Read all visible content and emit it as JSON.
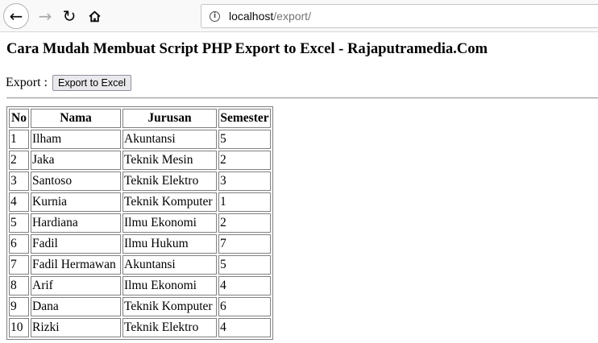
{
  "browser": {
    "url_host": "localhost",
    "url_path": "/export/",
    "icons": {
      "back": "back-arrow-icon",
      "forward": "forward-arrow-icon",
      "reload": "reload-icon",
      "home": "home-icon",
      "info": "info-icon"
    }
  },
  "page": {
    "title": "Cara Mudah Membuat Script PHP Export to Excel - Rajaputramedia.Com",
    "export_label": "Export :",
    "export_button": "Export to Excel"
  },
  "table": {
    "headers": [
      "No",
      "Nama",
      "Jurusan",
      "Semester"
    ],
    "rows": [
      [
        "1",
        "Ilham",
        "Akuntansi",
        "5"
      ],
      [
        "2",
        "Jaka",
        "Teknik Mesin",
        "2"
      ],
      [
        "3",
        "Santoso",
        "Teknik Elektro",
        "3"
      ],
      [
        "4",
        "Kurnia",
        "Teknik Komputer",
        "1"
      ],
      [
        "5",
        "Hardiana",
        "Ilmu Ekonomi",
        "2"
      ],
      [
        "6",
        "Fadil",
        "Ilmu Hukum",
        "7"
      ],
      [
        "7",
        "Fadil Hermawan",
        "Akuntansi",
        "5"
      ],
      [
        "8",
        "Arif",
        "Ilmu Ekonomi",
        "4"
      ],
      [
        "9",
        "Dana",
        "Teknik Komputer",
        "6"
      ],
      [
        "10",
        "Rizki",
        "Teknik Elektro",
        "4"
      ]
    ]
  }
}
